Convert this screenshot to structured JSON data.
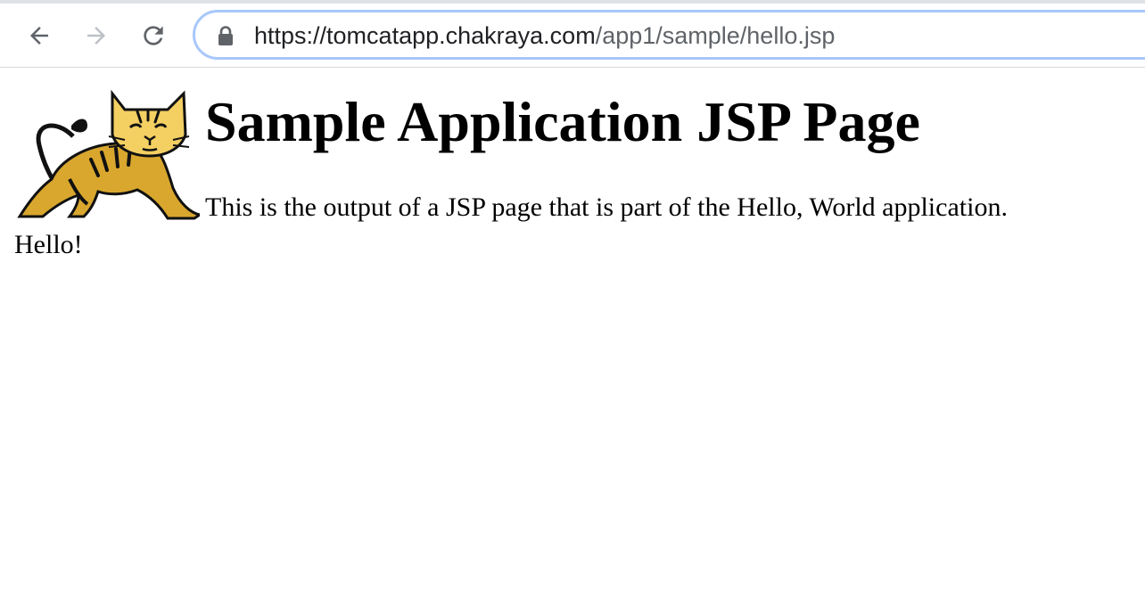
{
  "browser": {
    "url_scheme_host": "https://tomcatapp.chakraya.com",
    "url_path": "/app1/sample/hello.jsp",
    "icons": {
      "back": "arrow-left-icon",
      "forward": "arrow-right-icon",
      "reload": "reload-icon",
      "lock": "lock-icon"
    },
    "colors": {
      "icon_active": "#5f6368",
      "icon_disabled": "#bdc1c6",
      "omnibox_border": "#a8c7fa"
    }
  },
  "page": {
    "heading": "Sample Application JSP Page",
    "description": "This is the output of a JSP page that is part of the Hello, World application.",
    "greeting": "Hello!",
    "logo": "tomcat-logo"
  }
}
